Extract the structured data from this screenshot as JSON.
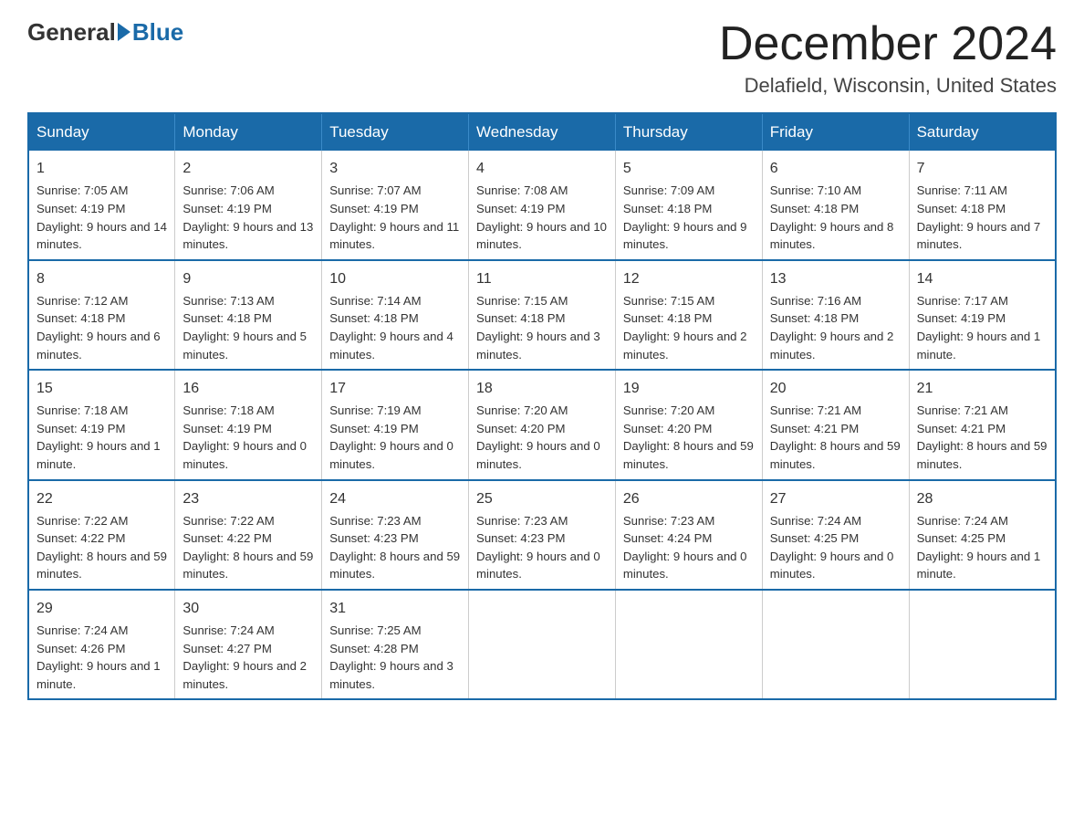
{
  "header": {
    "logo_general": "General",
    "logo_blue": "Blue",
    "month_title": "December 2024",
    "location": "Delafield, Wisconsin, United States"
  },
  "days_of_week": [
    "Sunday",
    "Monday",
    "Tuesday",
    "Wednesday",
    "Thursday",
    "Friday",
    "Saturday"
  ],
  "weeks": [
    [
      {
        "day": "1",
        "sunrise": "7:05 AM",
        "sunset": "4:19 PM",
        "daylight": "9 hours and 14 minutes."
      },
      {
        "day": "2",
        "sunrise": "7:06 AM",
        "sunset": "4:19 PM",
        "daylight": "9 hours and 13 minutes."
      },
      {
        "day": "3",
        "sunrise": "7:07 AM",
        "sunset": "4:19 PM",
        "daylight": "9 hours and 11 minutes."
      },
      {
        "day": "4",
        "sunrise": "7:08 AM",
        "sunset": "4:19 PM",
        "daylight": "9 hours and 10 minutes."
      },
      {
        "day": "5",
        "sunrise": "7:09 AM",
        "sunset": "4:18 PM",
        "daylight": "9 hours and 9 minutes."
      },
      {
        "day": "6",
        "sunrise": "7:10 AM",
        "sunset": "4:18 PM",
        "daylight": "9 hours and 8 minutes."
      },
      {
        "day": "7",
        "sunrise": "7:11 AM",
        "sunset": "4:18 PM",
        "daylight": "9 hours and 7 minutes."
      }
    ],
    [
      {
        "day": "8",
        "sunrise": "7:12 AM",
        "sunset": "4:18 PM",
        "daylight": "9 hours and 6 minutes."
      },
      {
        "day": "9",
        "sunrise": "7:13 AM",
        "sunset": "4:18 PM",
        "daylight": "9 hours and 5 minutes."
      },
      {
        "day": "10",
        "sunrise": "7:14 AM",
        "sunset": "4:18 PM",
        "daylight": "9 hours and 4 minutes."
      },
      {
        "day": "11",
        "sunrise": "7:15 AM",
        "sunset": "4:18 PM",
        "daylight": "9 hours and 3 minutes."
      },
      {
        "day": "12",
        "sunrise": "7:15 AM",
        "sunset": "4:18 PM",
        "daylight": "9 hours and 2 minutes."
      },
      {
        "day": "13",
        "sunrise": "7:16 AM",
        "sunset": "4:18 PM",
        "daylight": "9 hours and 2 minutes."
      },
      {
        "day": "14",
        "sunrise": "7:17 AM",
        "sunset": "4:19 PM",
        "daylight": "9 hours and 1 minute."
      }
    ],
    [
      {
        "day": "15",
        "sunrise": "7:18 AM",
        "sunset": "4:19 PM",
        "daylight": "9 hours and 1 minute."
      },
      {
        "day": "16",
        "sunrise": "7:18 AM",
        "sunset": "4:19 PM",
        "daylight": "9 hours and 0 minutes."
      },
      {
        "day": "17",
        "sunrise": "7:19 AM",
        "sunset": "4:19 PM",
        "daylight": "9 hours and 0 minutes."
      },
      {
        "day": "18",
        "sunrise": "7:20 AM",
        "sunset": "4:20 PM",
        "daylight": "9 hours and 0 minutes."
      },
      {
        "day": "19",
        "sunrise": "7:20 AM",
        "sunset": "4:20 PM",
        "daylight": "8 hours and 59 minutes."
      },
      {
        "day": "20",
        "sunrise": "7:21 AM",
        "sunset": "4:21 PM",
        "daylight": "8 hours and 59 minutes."
      },
      {
        "day": "21",
        "sunrise": "7:21 AM",
        "sunset": "4:21 PM",
        "daylight": "8 hours and 59 minutes."
      }
    ],
    [
      {
        "day": "22",
        "sunrise": "7:22 AM",
        "sunset": "4:22 PM",
        "daylight": "8 hours and 59 minutes."
      },
      {
        "day": "23",
        "sunrise": "7:22 AM",
        "sunset": "4:22 PM",
        "daylight": "8 hours and 59 minutes."
      },
      {
        "day": "24",
        "sunrise": "7:23 AM",
        "sunset": "4:23 PM",
        "daylight": "8 hours and 59 minutes."
      },
      {
        "day": "25",
        "sunrise": "7:23 AM",
        "sunset": "4:23 PM",
        "daylight": "9 hours and 0 minutes."
      },
      {
        "day": "26",
        "sunrise": "7:23 AM",
        "sunset": "4:24 PM",
        "daylight": "9 hours and 0 minutes."
      },
      {
        "day": "27",
        "sunrise": "7:24 AM",
        "sunset": "4:25 PM",
        "daylight": "9 hours and 0 minutes."
      },
      {
        "day": "28",
        "sunrise": "7:24 AM",
        "sunset": "4:25 PM",
        "daylight": "9 hours and 1 minute."
      }
    ],
    [
      {
        "day": "29",
        "sunrise": "7:24 AM",
        "sunset": "4:26 PM",
        "daylight": "9 hours and 1 minute."
      },
      {
        "day": "30",
        "sunrise": "7:24 AM",
        "sunset": "4:27 PM",
        "daylight": "9 hours and 2 minutes."
      },
      {
        "day": "31",
        "sunrise": "7:25 AM",
        "sunset": "4:28 PM",
        "daylight": "9 hours and 3 minutes."
      },
      null,
      null,
      null,
      null
    ]
  ],
  "labels": {
    "sunrise": "Sunrise: ",
    "sunset": "Sunset: ",
    "daylight": "Daylight: "
  }
}
